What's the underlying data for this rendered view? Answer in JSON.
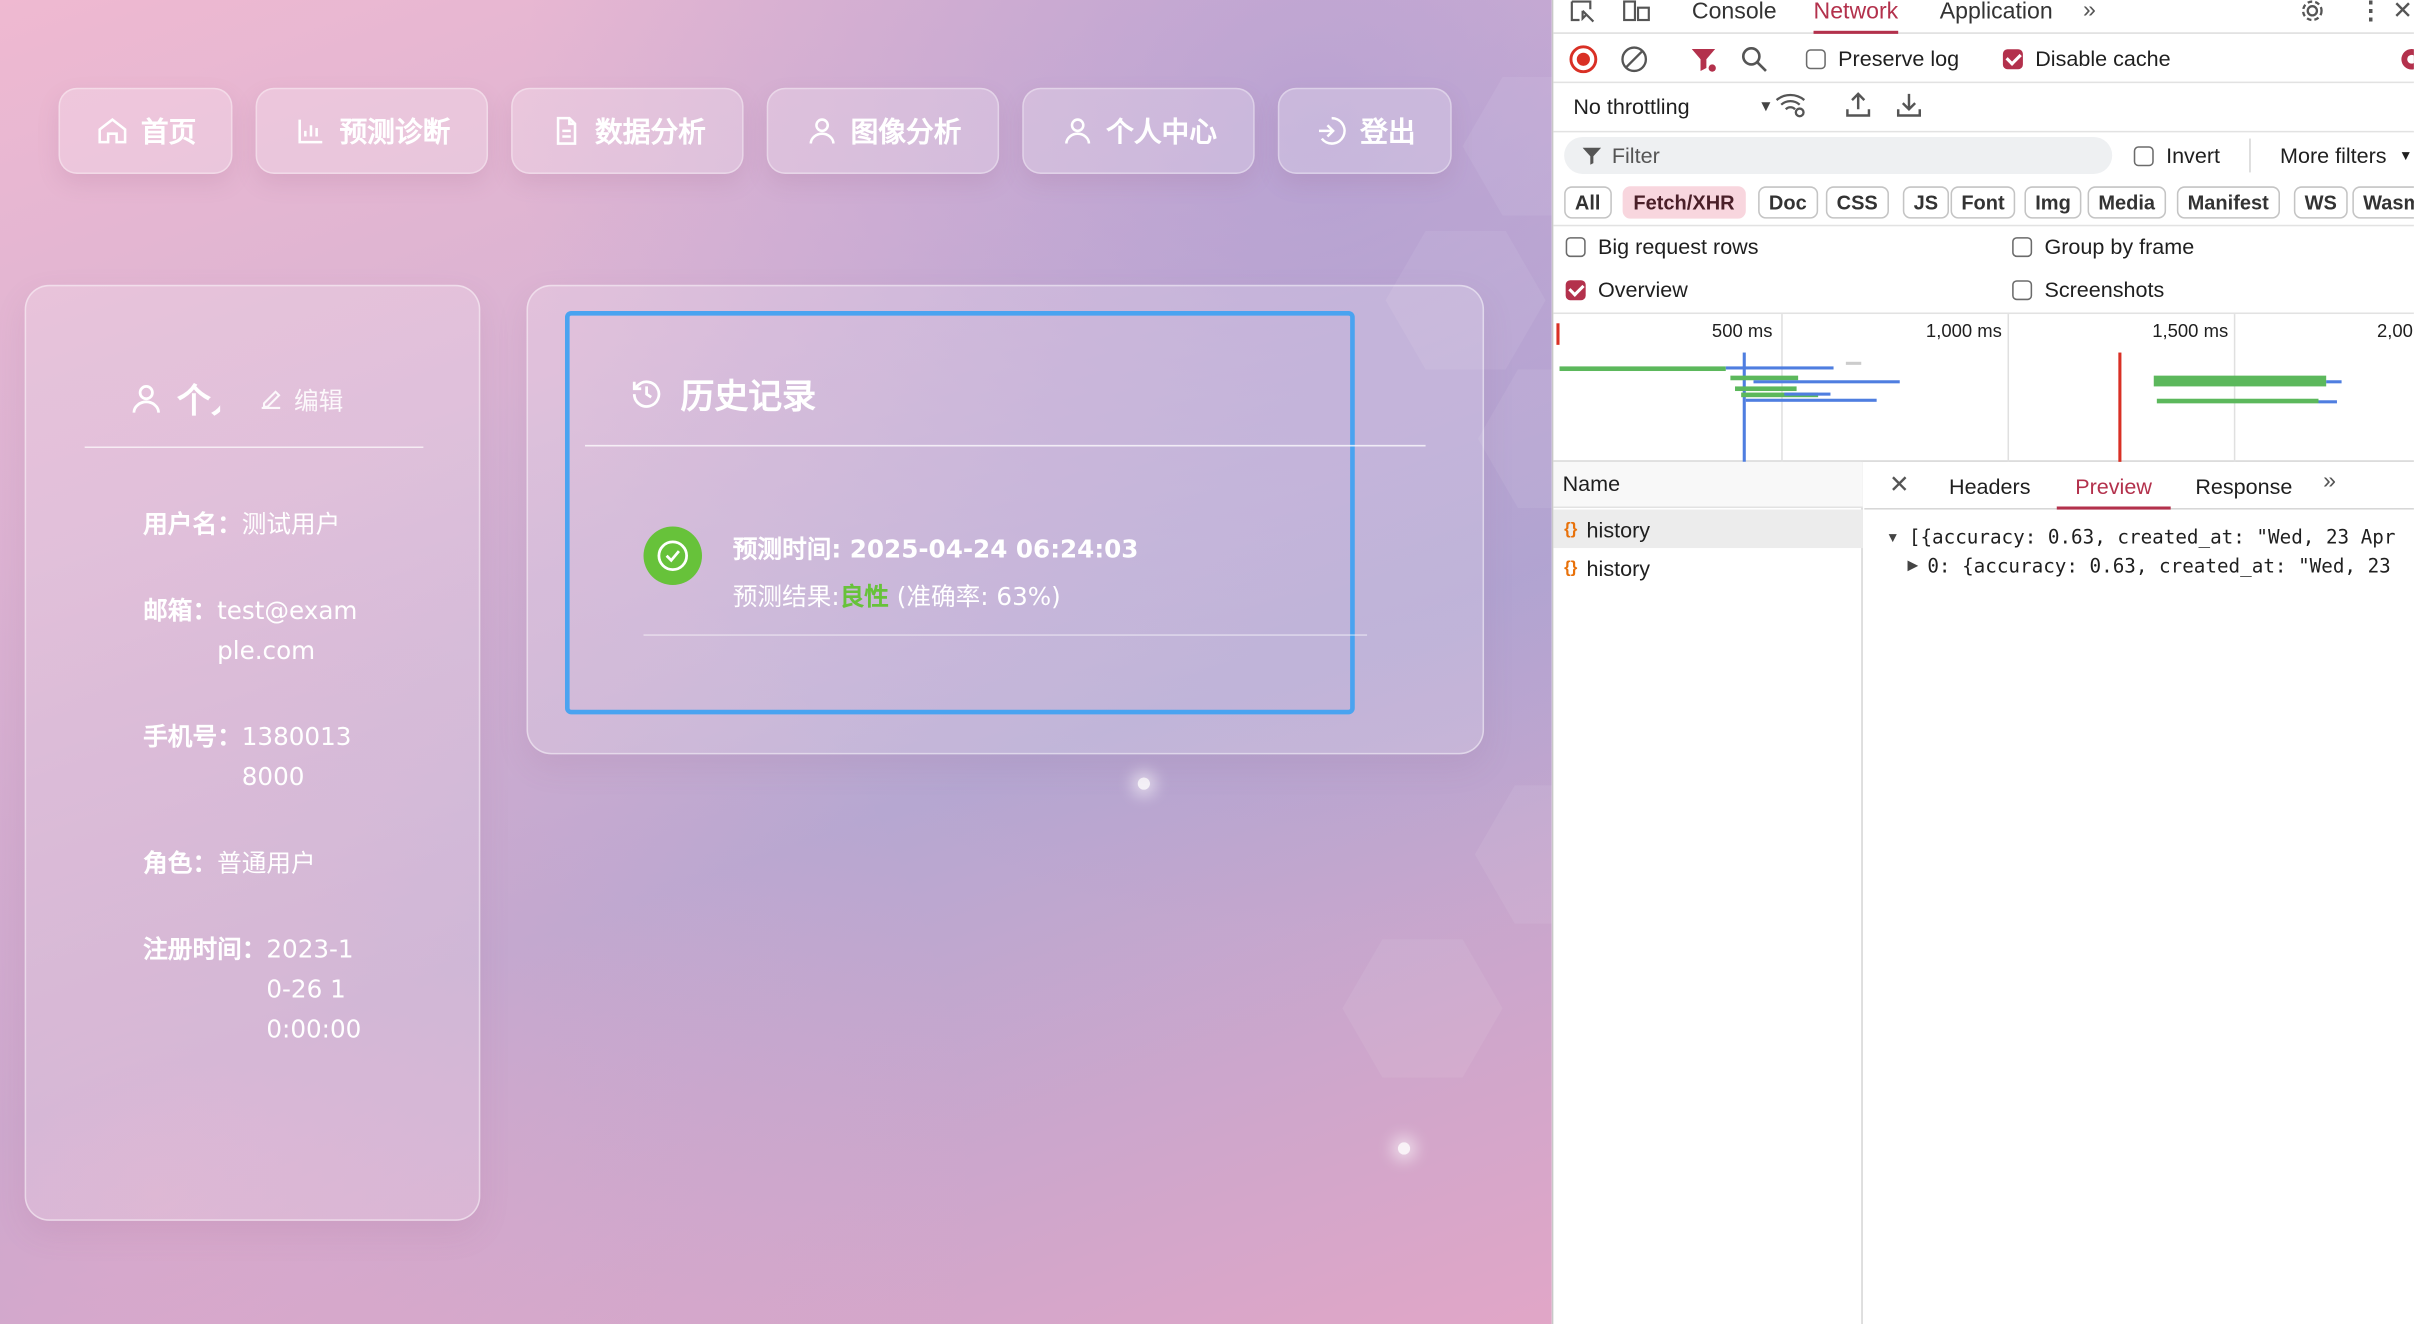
{
  "nav": [
    {
      "label": "首页",
      "icon": "home-icon"
    },
    {
      "label": "预测诊断",
      "icon": "bar-chart-icon"
    },
    {
      "label": "数据分析",
      "icon": "document-icon"
    },
    {
      "label": "图像分析",
      "icon": "user-icon"
    },
    {
      "label": "个人中心",
      "icon": "user-icon"
    },
    {
      "label": "登出",
      "icon": "logout-icon"
    }
  ],
  "profile": {
    "title": "个人",
    "edit_label": "编辑",
    "rows": [
      {
        "key": "用户名：",
        "value": "测试用户"
      },
      {
        "key": "邮箱：",
        "value": "test@example.com"
      },
      {
        "key": "手机号：",
        "value": "13800138000"
      },
      {
        "key": "角色：",
        "value": "普通用户"
      },
      {
        "key": "注册时间：",
        "value": "2023-10-26 10:00:00"
      }
    ]
  },
  "history": {
    "title": "历史记录",
    "items": [
      {
        "time_label": "预测时间: ",
        "time": "2025-04-24 06:24:03",
        "result_label": "预测结果:",
        "result": "良性",
        "accuracy": " (准确率: 63%)"
      }
    ]
  },
  "devtools": {
    "tabs": [
      "Console",
      "Network",
      "Application"
    ],
    "active_tab": "Network",
    "preserve_log": "Preserve log",
    "disable_cache": "Disable cache",
    "throttling": "No throttling",
    "filter_placeholder": "Filter",
    "invert": "Invert",
    "more_filters": "More filters",
    "chips": [
      "All",
      "Fetch/XHR",
      "Doc",
      "CSS",
      "JS",
      "Font",
      "Img",
      "Media",
      "Manifest",
      "WS",
      "Wasm"
    ],
    "active_chip": "Fetch/XHR",
    "options": {
      "big_rows": "Big request rows",
      "group_by_frame": "Group by frame",
      "overview": "Overview",
      "screenshots": "Screenshots"
    },
    "timeline_ticks": [
      "500 ms",
      "1,000 ms",
      "1,500 ms",
      "2,00"
    ],
    "name_header": "Name",
    "requests": [
      "history",
      "history"
    ],
    "detail_tabs": [
      "Headers",
      "Preview",
      "Response"
    ],
    "active_detail_tab": "Preview",
    "preview_lines": [
      "[{accuracy: 0.63, created_at: \"Wed, 23 Apr",
      "0: {accuracy: 0.63, created_at: \"Wed, 23"
    ],
    "colors": {
      "accent": "#b3314c",
      "chip_active_bg": "#f8d6de",
      "bar_blue": "#4f7ee0",
      "bar_green": "#5cb85c"
    }
  }
}
